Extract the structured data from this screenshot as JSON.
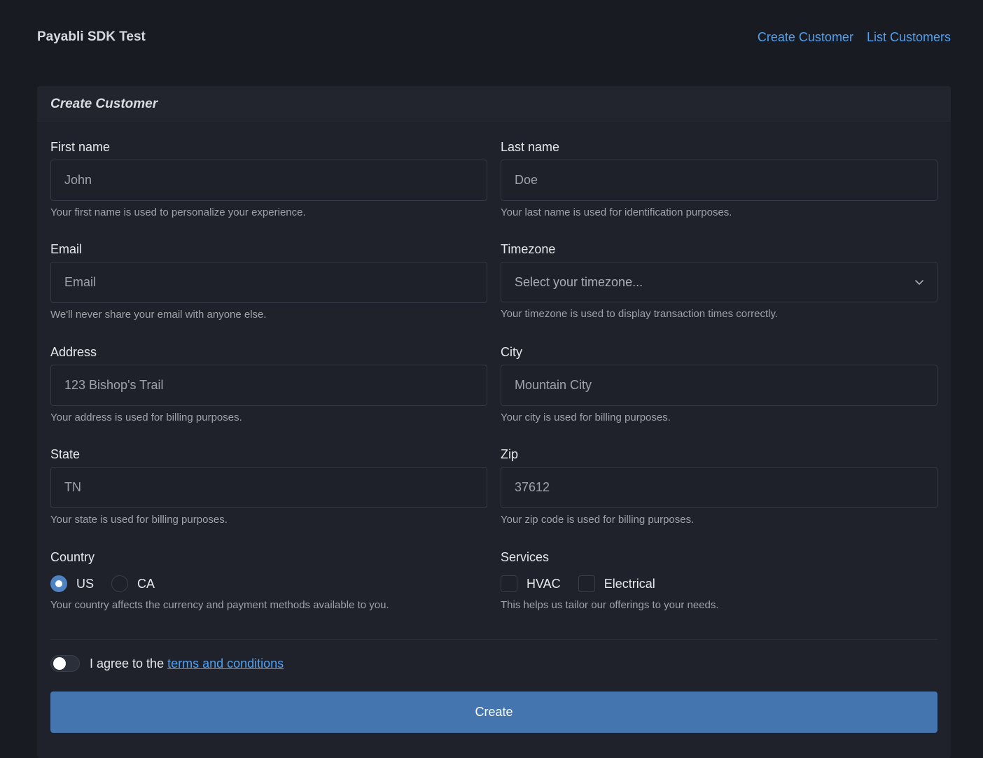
{
  "app": {
    "title": "Payabli SDK Test"
  },
  "nav": {
    "create_customer": "Create Customer",
    "list_customers": "List Customers"
  },
  "form": {
    "title": "Create Customer",
    "first_name": {
      "label": "First name",
      "placeholder": "John",
      "help": "Your first name is used to personalize your experience."
    },
    "last_name": {
      "label": "Last name",
      "placeholder": "Doe",
      "help": "Your last name is used for identification purposes."
    },
    "email": {
      "label": "Email",
      "placeholder": "Email",
      "help": "We'll never share your email with anyone else."
    },
    "timezone": {
      "label": "Timezone",
      "selected": "Select your timezone...",
      "help": "Your timezone is used to display transaction times correctly.",
      "icon": "chevron-down-icon"
    },
    "address": {
      "label": "Address",
      "placeholder": "123 Bishop's Trail",
      "help": "Your address is used for billing purposes."
    },
    "city": {
      "label": "City",
      "placeholder": "Mountain City",
      "help": "Your city is used for billing purposes."
    },
    "state": {
      "label": "State",
      "placeholder": "TN",
      "help": "Your state is used for billing purposes."
    },
    "zip": {
      "label": "Zip",
      "placeholder": "37612",
      "help": "Your zip code is used for billing purposes."
    },
    "country": {
      "label": "Country",
      "options": [
        "US",
        "CA"
      ],
      "selected": "US",
      "help": "Your country affects the currency and payment methods available to you."
    },
    "services": {
      "label": "Services",
      "options": [
        "HVAC",
        "Electrical"
      ],
      "help": "This helps us tailor our offerings to your needs."
    },
    "agree": {
      "text": "I agree to the",
      "link": "terms and conditions"
    },
    "submit_label": "Create"
  },
  "colors": {
    "background": "#181b22",
    "card": "#1f222b",
    "accent_link": "#4ea1f3",
    "primary_button": "#4475ae",
    "radio_checked": "#4d82c3"
  }
}
